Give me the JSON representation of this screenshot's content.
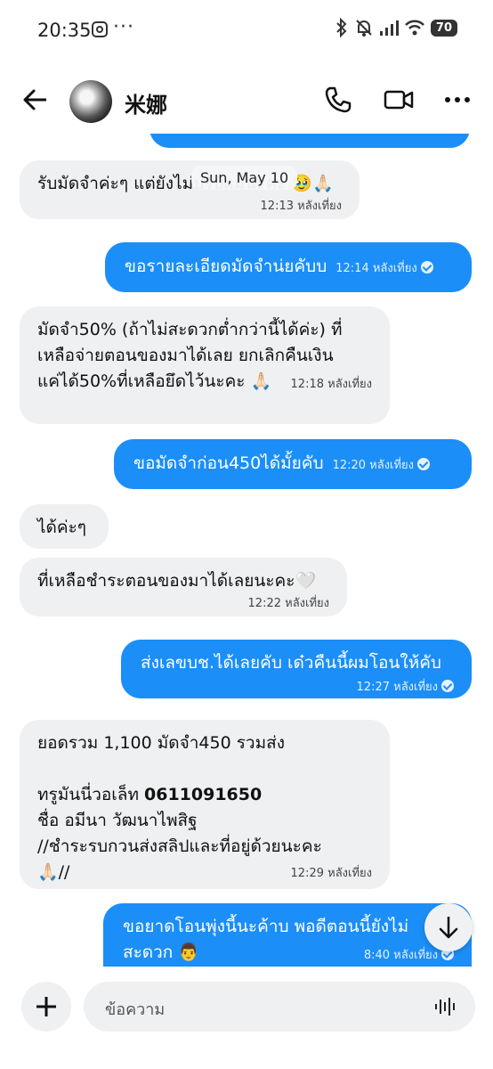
{
  "status": {
    "time": "20:35",
    "dots": "···",
    "battery": "70"
  },
  "header": {
    "name": "米娜"
  },
  "chat": {
    "date_chip": "Sun, May 10",
    "messages": [
      {
        "dir": "in",
        "text": "รับมัดจำค่ะๆ แต่ยังไม่ปรับผมนะคะ 🥹🙏🏻",
        "time": "12:13 หลังเที่ยง"
      },
      {
        "dir": "out",
        "text": "ขอรายละเอียดมัดจำน่ยคับบ",
        "time": "12:14 หลังเที่ยง"
      },
      {
        "dir": "in",
        "lines": [
          "มัดจำ50% (ถ้าไม่สะดวกต่ำกว่านี้ได้ค่ะ) ที่",
          "เหลือจ่ายตอนของมาได้เลย ยกเลิกคืนเงิน",
          "แค่ได้50%ที่เหลือยึดไว้นะคะ 🙏🏻"
        ],
        "time": "12:18 หลังเที่ยง"
      },
      {
        "dir": "out",
        "text": "ขอมัดจำก่อน450ได้มั้ยคับ",
        "time": "12:20 หลังเที่ยง"
      },
      {
        "dir": "in",
        "text": "ได้ค่ะๆ"
      },
      {
        "dir": "in",
        "text": "ที่เหลือชำระตอนของมาได้เลยนะคะ🤍",
        "time": "12:22 หลังเที่ยง"
      },
      {
        "dir": "out",
        "text": "ส่งเลขบช.ได้เลยคับ เด๋วคืนนี้ผมโอนให้คับ",
        "time": "12:27 หลังเที่ยง"
      },
      {
        "dir": "in",
        "line1": "ยอดรวม 1,100 มัดจำ450 รวมส่ง",
        "line2_prefix": "ทรูมันนี่วอเล็ท ",
        "phone": "0611091650",
        "line3": "ชื่อ อมีนา วัฒนาไพสิฐ",
        "line4": "//ชำระรบกวนส่งสลิปและที่อยู่ด้วยนะคะ",
        "line5": "🙏🏻//",
        "time": "12:29 หลังเที่ยง"
      },
      {
        "dir": "out",
        "lines": [
          "ขอยาดโอนพุ่งนี้นะค้าบ พอดีตอนนี้ยังไม่",
          "สะดวก 👨"
        ],
        "time": "8:40 หลังเที่ยง"
      }
    ]
  },
  "composer": {
    "placeholder": "ข้อความ"
  }
}
